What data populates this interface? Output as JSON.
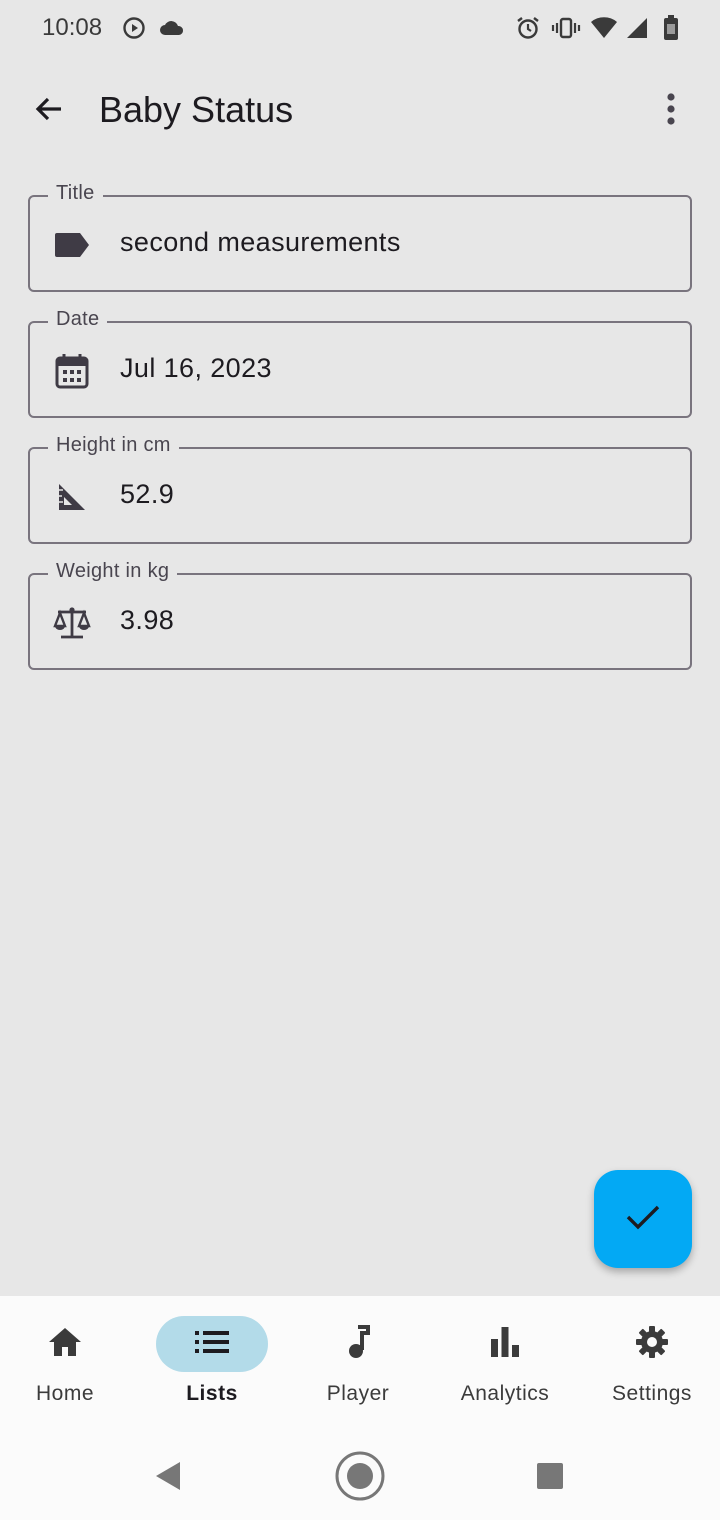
{
  "status_bar": {
    "time": "10:08",
    "left_icons": [
      "play-circle-icon",
      "cloud-icon"
    ],
    "right_icons": [
      "alarm-icon",
      "vibrate-icon",
      "wifi-icon",
      "signal-icon",
      "battery-icon"
    ]
  },
  "app_bar": {
    "title": "Baby Status",
    "back_icon": "arrow-back-icon",
    "menu_icon": "more-vert-icon"
  },
  "form": {
    "fields": [
      {
        "label": "Title",
        "value": "second measurements",
        "icon": "label-icon"
      },
      {
        "label": "Date",
        "value": "Jul 16, 2023",
        "icon": "calendar-icon"
      },
      {
        "label": "Height in cm",
        "value": "52.9",
        "icon": "ruler-icon"
      },
      {
        "label": "Weight in kg",
        "value": "3.98",
        "icon": "scale-icon"
      }
    ]
  },
  "fab": {
    "icon": "check-icon",
    "color": "#03a9f4"
  },
  "bottom_nav": {
    "items": [
      {
        "label": "Home",
        "icon": "home-icon",
        "active": false
      },
      {
        "label": "Lists",
        "icon": "list-icon",
        "active": true
      },
      {
        "label": "Player",
        "icon": "music-note-icon",
        "active": false
      },
      {
        "label": "Analytics",
        "icon": "bar-chart-icon",
        "active": false
      },
      {
        "label": "Settings",
        "icon": "gear-icon",
        "active": false
      }
    ],
    "active_color": "#b3dbe9"
  },
  "system_nav": {
    "buttons": [
      "back-triangle-icon",
      "home-circle-icon",
      "recents-square-icon"
    ]
  }
}
